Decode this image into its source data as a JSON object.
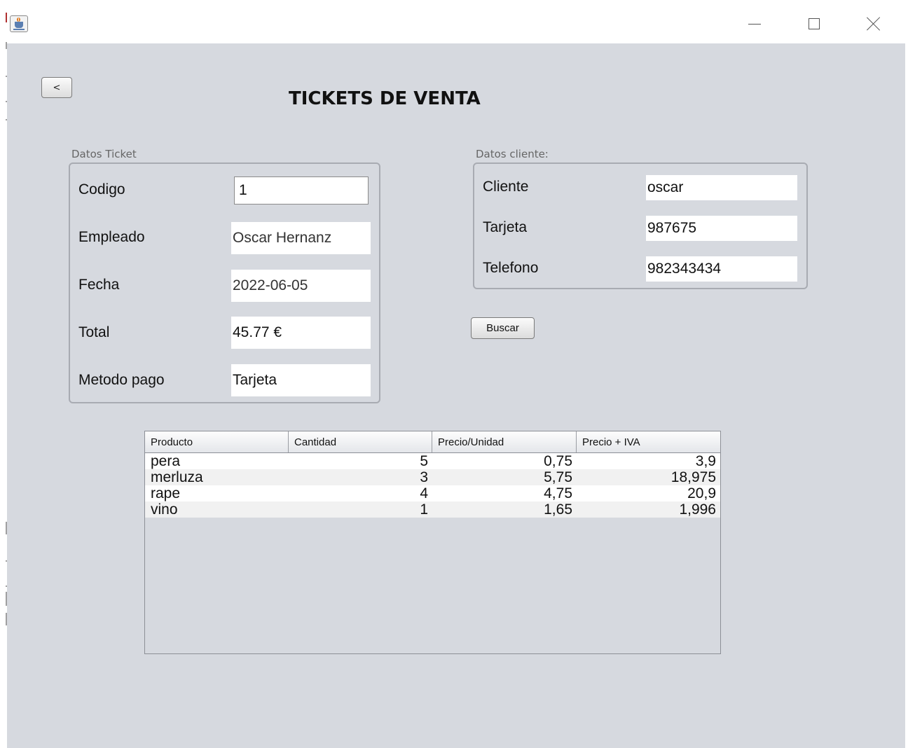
{
  "window": {
    "icon": "java-cup-icon",
    "controls": [
      "minimize-icon",
      "maximize-icon",
      "close-icon"
    ]
  },
  "toolbar": {
    "back_label": "<"
  },
  "page_title": "TICKETS DE VENTA",
  "ticket": {
    "legend": "Datos Ticket",
    "codigo_label": "Codigo",
    "codigo_value": "1",
    "empleado_label": "Empleado",
    "empleado_value": "Oscar Hernanz",
    "fecha_label": "Fecha",
    "fecha_value": "2022-06-05",
    "total_label": "Total",
    "total_value": "45.77 €",
    "metodo_label": "Metodo pago",
    "metodo_value": "Tarjeta"
  },
  "cliente": {
    "legend": "Datos cliente:",
    "cliente_label": "Cliente",
    "cliente_value": "oscar",
    "tarjeta_label": "Tarjeta",
    "tarjeta_value": "987675",
    "telefono_label": "Telefono",
    "telefono_value": "982343434"
  },
  "buscar_label": "Buscar",
  "table": {
    "columns": [
      "Producto",
      "Cantidad",
      "Precio/Unidad",
      "Precio + IVA"
    ],
    "rows": [
      [
        "pera",
        "5",
        "0,75",
        "3,9"
      ],
      [
        "merluza",
        "3",
        "5,75",
        "18,975"
      ],
      [
        "rape",
        "4",
        "4,75",
        "20,9"
      ],
      [
        "vino",
        "1",
        "1,65",
        "1,996"
      ]
    ]
  },
  "colors": {
    "background": "#d6d9df",
    "titlebar": "#ffffff",
    "field": "#ffffff"
  }
}
